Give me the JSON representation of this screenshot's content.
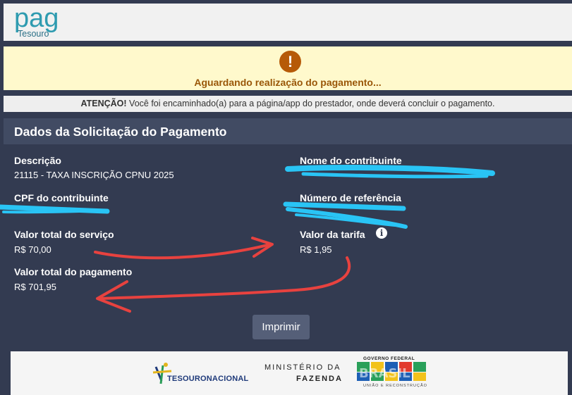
{
  "logo": {
    "letters": "pag",
    "sub": "Tesouro"
  },
  "alert": {
    "icon": "exclamation-icon",
    "message": "Aguardando realização do pagamento..."
  },
  "attention": {
    "prefix": "ATENÇÃO!",
    "message": "Você foi encaminhado(a) para a página/app do prestador, onde deverá concluir o pagamento."
  },
  "section": {
    "title": "Dados da Solicitação do Pagamento"
  },
  "fields": {
    "descricao": {
      "label": "Descrição",
      "value": "21115 - TAXA INSCRIÇÃO CPNU 2025"
    },
    "nome": {
      "label": "Nome do contribuinte"
    },
    "cpf": {
      "label": "CPF do contribuinte"
    },
    "referencia": {
      "label": "Número de referência"
    },
    "valor_servico": {
      "label": "Valor total do serviço",
      "value": "R$  70,00"
    },
    "tarifa": {
      "label": "Valor da tarifa",
      "value": "R$  1,95"
    },
    "valor_pagamento": {
      "label": "Valor total do pagamento",
      "value": "R$  701,95"
    }
  },
  "buttons": {
    "print": "Imprimir"
  },
  "footer": {
    "tesouro_nacional": "TESOURONACIONAL",
    "ministerio_line1": "MINISTÉRIO DA",
    "ministerio_line2": "FAZENDA",
    "governo": "GOVERNO FEDERAL",
    "brasil": "BRASIL",
    "uniao": "UNIÃO E RECONSTRUÇÃO"
  },
  "colors": {
    "background": "#333b51",
    "alert_bg": "#fff9cc",
    "alert_accent": "#b65a08",
    "redaction": "#29c4f5",
    "annotation": "#e8423f"
  }
}
